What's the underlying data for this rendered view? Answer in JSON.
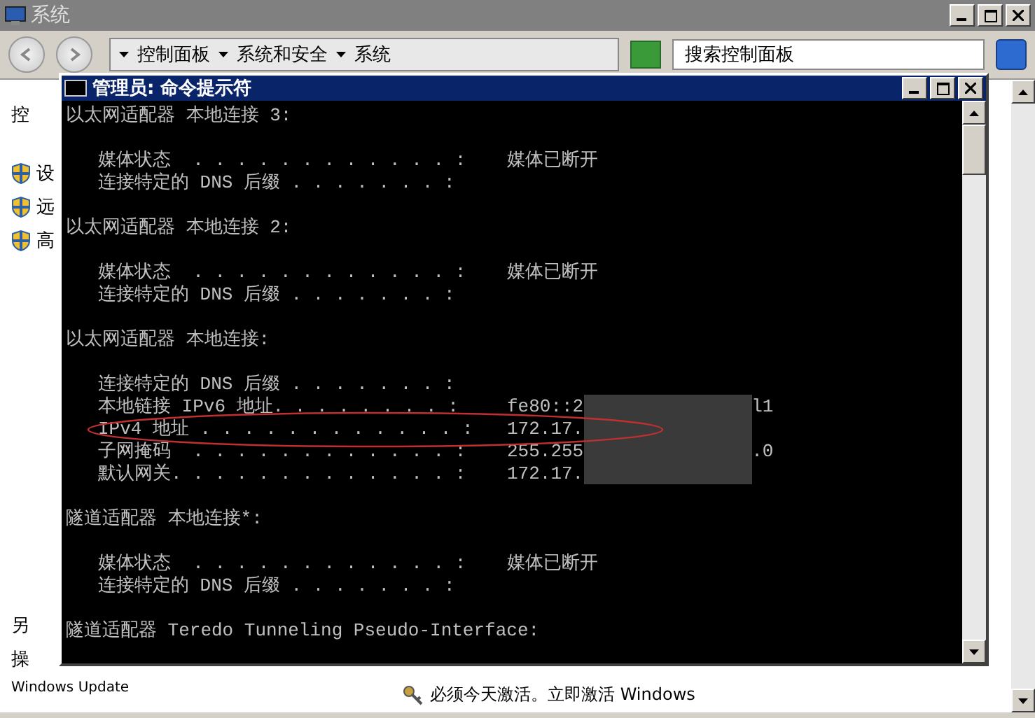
{
  "window": {
    "title": "系统"
  },
  "address_bar": {
    "crumbs": [
      "控制面板",
      "系统和安全",
      "系统"
    ],
    "search": {
      "placeholder": "搜索控制面板"
    }
  },
  "sidebar": {
    "top": "控",
    "links": [
      "设",
      "远",
      "高"
    ],
    "bottom": [
      "另",
      "操",
      "Windows Update"
    ]
  },
  "footer": {
    "activation": "必须今天激活。立即激活 Windows"
  },
  "cmd": {
    "title": "管理员: 命令提示符",
    "lines": [
      {
        "kind": "heading",
        "text": "以太网适配器 本地连接 3:"
      },
      {
        "kind": "blank"
      },
      {
        "kind": "field",
        "text": "媒体状态  . . . . . . . . . . . . :",
        "value": "媒体已断开"
      },
      {
        "kind": "field",
        "text": "连接特定的 DNS 后缀 . . . . . . . :"
      },
      {
        "kind": "blank"
      },
      {
        "kind": "heading",
        "text": "以太网适配器 本地连接 2:"
      },
      {
        "kind": "blank"
      },
      {
        "kind": "field",
        "text": "媒体状态  . . . . . . . . . . . . :",
        "value": "媒体已断开"
      },
      {
        "kind": "field",
        "text": "连接特定的 DNS 后缀 . . . . . . . :"
      },
      {
        "kind": "blank"
      },
      {
        "kind": "heading",
        "text": "以太网适配器 本地连接:"
      },
      {
        "kind": "blank"
      },
      {
        "kind": "field",
        "text": "连接特定的 DNS 后缀 . . . . . . . :"
      },
      {
        "kind": "field",
        "text": "本地链接 IPv6 地址. . . . . . . . :",
        "value": "fe80::2",
        "tail": "l1",
        "redacted": true
      },
      {
        "kind": "field",
        "text": "IPv4 地址 . . . . . . . . . . . . :",
        "value": "172.17.",
        "redacted": true,
        "circled": true
      },
      {
        "kind": "field",
        "text": "子网掩码  . . . . . . . . . . . . :",
        "value": "255.255",
        "tail": ".0",
        "redacted": true
      },
      {
        "kind": "field",
        "text": "默认网关. . . . . . . . . . . . . :",
        "value": "172.17.",
        "redacted": true
      },
      {
        "kind": "blank"
      },
      {
        "kind": "heading",
        "text": "隧道适配器 本地连接*:"
      },
      {
        "kind": "blank"
      },
      {
        "kind": "field",
        "text": "媒体状态  . . . . . . . . . . . . :",
        "value": "媒体已断开"
      },
      {
        "kind": "field",
        "text": "连接特定的 DNS 后缀 . . . . . . . :"
      },
      {
        "kind": "blank"
      },
      {
        "kind": "heading",
        "text": "隧道适配器 Teredo Tunneling Pseudo-Interface:"
      }
    ]
  }
}
